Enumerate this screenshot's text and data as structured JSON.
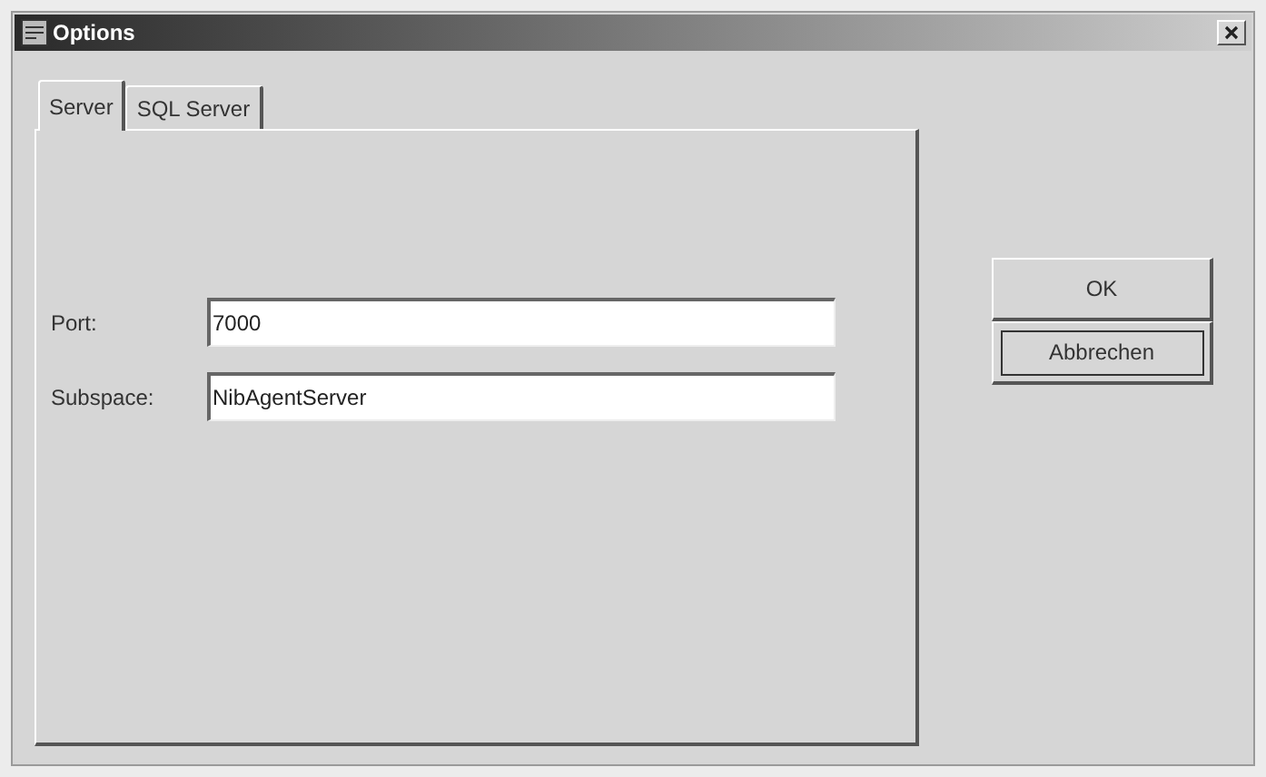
{
  "window": {
    "title": "Options"
  },
  "tabs": [
    {
      "label": "Server",
      "selected": true
    },
    {
      "label": "SQL Server",
      "selected": false
    }
  ],
  "fields": [
    {
      "label": "Port:",
      "value": "7000"
    },
    {
      "label": "Subspace:",
      "value": "NibAgentServer"
    }
  ],
  "buttons": [
    {
      "label": "OK",
      "default": false
    },
    {
      "label": "Abbrechen",
      "default": true
    }
  ]
}
